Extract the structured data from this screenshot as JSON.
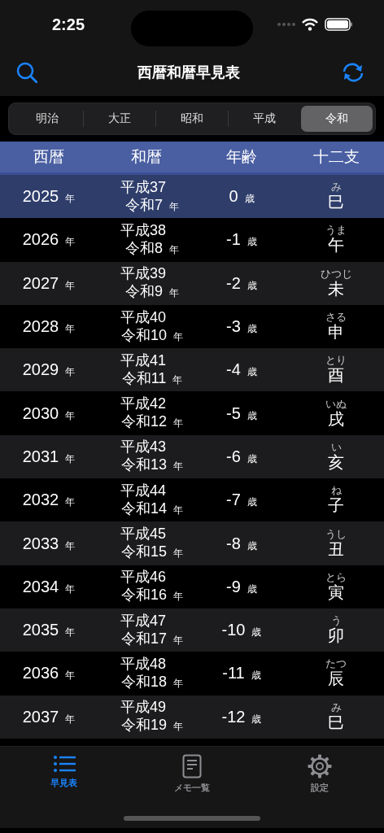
{
  "status_bar": {
    "time": "2:25"
  },
  "nav": {
    "title": "西暦和暦早見表"
  },
  "segments": [
    {
      "label": "明治",
      "selected": false
    },
    {
      "label": "大正",
      "selected": false
    },
    {
      "label": "昭和",
      "selected": false
    },
    {
      "label": "平成",
      "selected": false
    },
    {
      "label": "令和",
      "selected": true
    }
  ],
  "table": {
    "columns": [
      "西暦",
      "和暦",
      "年齢",
      "十二支"
    ],
    "rows": [
      {
        "year": "2025",
        "year_unit": "年",
        "era_1": "平成37",
        "era_2": "令和7",
        "era_unit": "年",
        "age": "0",
        "age_unit": "歳",
        "reading": "み",
        "zodiac": "巳",
        "selected": true
      },
      {
        "year": "2026",
        "year_unit": "年",
        "era_1": "平成38",
        "era_2": "令和8",
        "era_unit": "年",
        "age": "-1",
        "age_unit": "歳",
        "reading": "うま",
        "zodiac": "午",
        "selected": false
      },
      {
        "year": "2027",
        "year_unit": "年",
        "era_1": "平成39",
        "era_2": "令和9",
        "era_unit": "年",
        "age": "-2",
        "age_unit": "歳",
        "reading": "ひつじ",
        "zodiac": "未",
        "selected": false
      },
      {
        "year": "2028",
        "year_unit": "年",
        "era_1": "平成40",
        "era_2": "令和10",
        "era_unit": "年",
        "age": "-3",
        "age_unit": "歳",
        "reading": "さる",
        "zodiac": "申",
        "selected": false
      },
      {
        "year": "2029",
        "year_unit": "年",
        "era_1": "平成41",
        "era_2": "令和11",
        "era_unit": "年",
        "age": "-4",
        "age_unit": "歳",
        "reading": "とり",
        "zodiac": "酉",
        "selected": false
      },
      {
        "year": "2030",
        "year_unit": "年",
        "era_1": "平成42",
        "era_2": "令和12",
        "era_unit": "年",
        "age": "-5",
        "age_unit": "歳",
        "reading": "いぬ",
        "zodiac": "戌",
        "selected": false
      },
      {
        "year": "2031",
        "year_unit": "年",
        "era_1": "平成43",
        "era_2": "令和13",
        "era_unit": "年",
        "age": "-6",
        "age_unit": "歳",
        "reading": "い",
        "zodiac": "亥",
        "selected": false
      },
      {
        "year": "2032",
        "year_unit": "年",
        "era_1": "平成44",
        "era_2": "令和14",
        "era_unit": "年",
        "age": "-7",
        "age_unit": "歳",
        "reading": "ね",
        "zodiac": "子",
        "selected": false
      },
      {
        "year": "2033",
        "year_unit": "年",
        "era_1": "平成45",
        "era_2": "令和15",
        "era_unit": "年",
        "age": "-8",
        "age_unit": "歳",
        "reading": "うし",
        "zodiac": "丑",
        "selected": false
      },
      {
        "year": "2034",
        "year_unit": "年",
        "era_1": "平成46",
        "era_2": "令和16",
        "era_unit": "年",
        "age": "-9",
        "age_unit": "歳",
        "reading": "とら",
        "zodiac": "寅",
        "selected": false
      },
      {
        "year": "2035",
        "year_unit": "年",
        "era_1": "平成47",
        "era_2": "令和17",
        "era_unit": "年",
        "age": "-10",
        "age_unit": "歳",
        "reading": "う",
        "zodiac": "卯",
        "selected": false
      },
      {
        "year": "2036",
        "year_unit": "年",
        "era_1": "平成48",
        "era_2": "令和18",
        "era_unit": "年",
        "age": "-11",
        "age_unit": "歳",
        "reading": "たつ",
        "zodiac": "辰",
        "selected": false
      },
      {
        "year": "2037",
        "year_unit": "年",
        "era_1": "平成49",
        "era_2": "令和19",
        "era_unit": "年",
        "age": "-12",
        "age_unit": "歳",
        "reading": "み",
        "zodiac": "巳",
        "selected": false
      }
    ]
  },
  "tab_bar": [
    {
      "kind": "list",
      "label": "早見表",
      "selected": true
    },
    {
      "kind": "memo",
      "label": "メモ一覧",
      "selected": false
    },
    {
      "kind": "settings",
      "label": "設定",
      "selected": false
    }
  ]
}
